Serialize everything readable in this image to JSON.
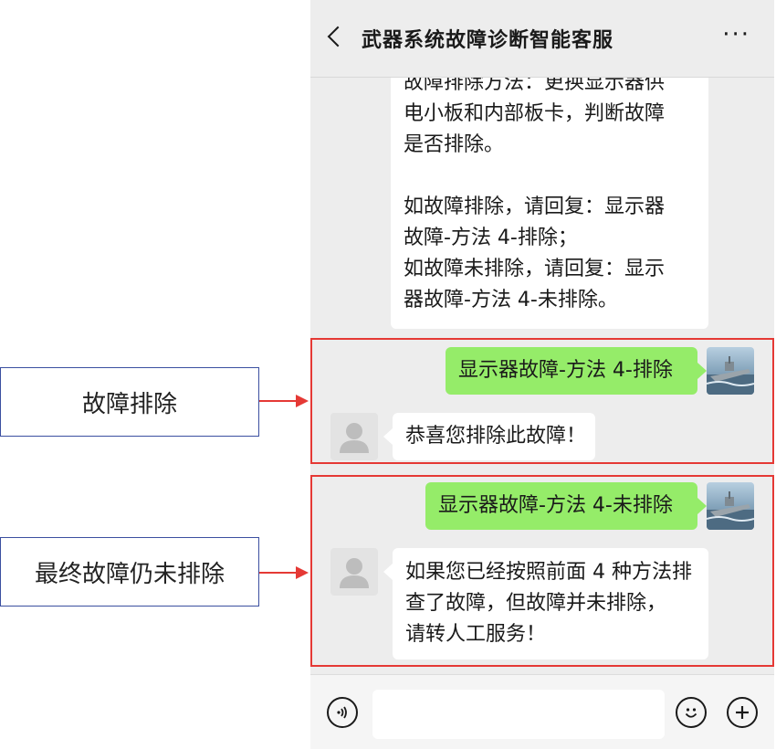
{
  "header": {
    "title": "武器系统故障诊断智能客服",
    "back_icon": "chevron-left-icon",
    "more_icon": "more-icon",
    "more_glyph": "···"
  },
  "messages": {
    "bot_intro": {
      "lines": [
        "故障排除方法：更换显示器供",
        "电小板和内部板卡，判断故障",
        "是否排除。",
        "",
        "如故障排除，请回复：显示器",
        "故障-方法 4-排除；",
        "如故障未排除，请回复：显示",
        "器故障-方法 4-未排除。"
      ]
    },
    "user_resolved": "显示器故障-方法 4-排除",
    "bot_resolved": "恭喜您排除此故障！",
    "user_unresolved": "显示器故障-方法 4-未排除",
    "bot_unresolved": {
      "lines": [
        "如果您已经按照前面 4 种方法排",
        "查了故障，但故障并未排除，",
        "请转人工服务！"
      ]
    }
  },
  "annotations": {
    "resolved_label": "故障排除",
    "unresolved_label": "最终故障仍未排除"
  },
  "input_bar": {
    "voice_icon": "voice-icon",
    "emoji_icon": "emoji-icon",
    "plus_icon": "plus-icon",
    "input_value": ""
  },
  "colors": {
    "chat_background": "#ededed",
    "user_bubble": "#95ec69",
    "bot_bubble": "#ffffff",
    "highlight_border": "#e53935",
    "label_border": "#3b4fa0"
  }
}
